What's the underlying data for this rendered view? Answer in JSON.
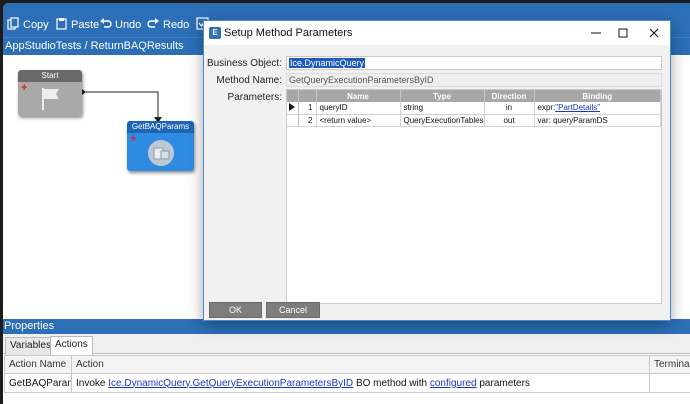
{
  "toolbar": {
    "copy": "Copy",
    "paste": "Paste",
    "undo": "Undo",
    "redo": "Redo"
  },
  "breadcrumb": "AppStudioTests / ReturnBAQResults",
  "canvas": {
    "start_node": "Start",
    "method_node": "GetBAQParams"
  },
  "dialog": {
    "title": "Setup Method Parameters",
    "business_object_label": "Business Object:",
    "business_object_value": "Ice.DynamicQuery",
    "method_name_label": "Method Name:",
    "method_name_value": "GetQueryExecutionParametersByID",
    "parameters_label": "Parameters:",
    "columns": [
      "Name",
      "Type",
      "Direction",
      "Binding"
    ],
    "rows": [
      {
        "num": "1",
        "name": "queryID",
        "type": "string",
        "direction": "in",
        "binding_prefix": "expr:",
        "binding_value": "\"PartDetails\""
      },
      {
        "num": "2",
        "name": "<return value>",
        "type": "QueryExecutionTableset",
        "direction": "out",
        "binding_prefix": "var:",
        "binding_value": "queryParamDS"
      }
    ],
    "ok": "OK",
    "cancel": "Cancel"
  },
  "properties": {
    "header": "Properties",
    "tabs": [
      "Variables",
      "Actions"
    ],
    "active_tab": "Actions",
    "columns": [
      "Action Name",
      "Action",
      "Termina"
    ],
    "row": {
      "action_name": "GetBAQParams",
      "invoke": "Invoke",
      "method_link": "Ice.DynamicQuery.GetQueryExecutionParametersByID",
      "bo_method_with": "BO method with",
      "configured_link": "configured",
      "parameters": "parameters"
    }
  },
  "colors": {
    "accent": "#2c6fb7",
    "link": "#1a36c9",
    "selection": "#1f5bbd",
    "grid_header": "#a7a7a7",
    "button": "#7d7d7d"
  }
}
